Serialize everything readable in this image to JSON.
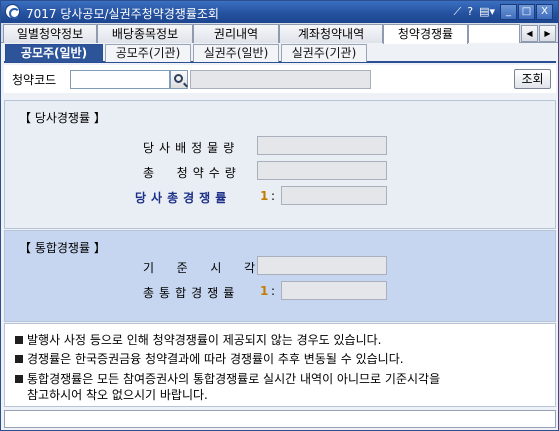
{
  "window": {
    "title": "7017 당사공모/실권주청약경쟁률조회",
    "tools": [
      "⟋",
      "?",
      "▤▾"
    ],
    "buttons": {
      "minimize": "_",
      "maximize": "□",
      "close": "X"
    }
  },
  "main_tabs": [
    "일별청약정보",
    "배당종목정보",
    "권리내역",
    "계좌청약내역",
    "청약경쟁률"
  ],
  "main_tab_active": "청약경쟁률",
  "sub_tabs": [
    "공모주(일반)",
    "공모주(기관)",
    "실권주(일반)",
    "실권주(기관)"
  ],
  "sub_tab_active": "공모주(일반)",
  "search": {
    "label": "청약코드",
    "value": "",
    "query_button": "조회"
  },
  "company_panel": {
    "header": "【 당사경쟁률 】",
    "rows": [
      {
        "label": "당사배정물량",
        "value": ""
      },
      {
        "label": "총  청약수량",
        "value": ""
      },
      {
        "label": "당사총경쟁률",
        "value": "",
        "prefix": "1",
        "colon": ":"
      }
    ]
  },
  "integrated_panel": {
    "header": "【 통합경쟁률 】",
    "rows": [
      {
        "label": "기  준  시  각",
        "value": ""
      },
      {
        "label": "총통합경쟁률",
        "value": "",
        "prefix": "1",
        "colon": ":"
      }
    ]
  },
  "notices": [
    "발행사 사정 등으로 인해 청약경쟁률이 제공되지 않는 경우도 있습니다.",
    "경쟁률은 한국증권금융 청약결과에 따라 경쟁률이 추후 변동될 수 있습니다.",
    "통합경쟁률은 모든 참여증권사의 통합경쟁률로 실시간 내역이 아니므로 기준시각을",
    "참고하시어 착오 없으시기 바랍니다."
  ],
  "status": ""
}
